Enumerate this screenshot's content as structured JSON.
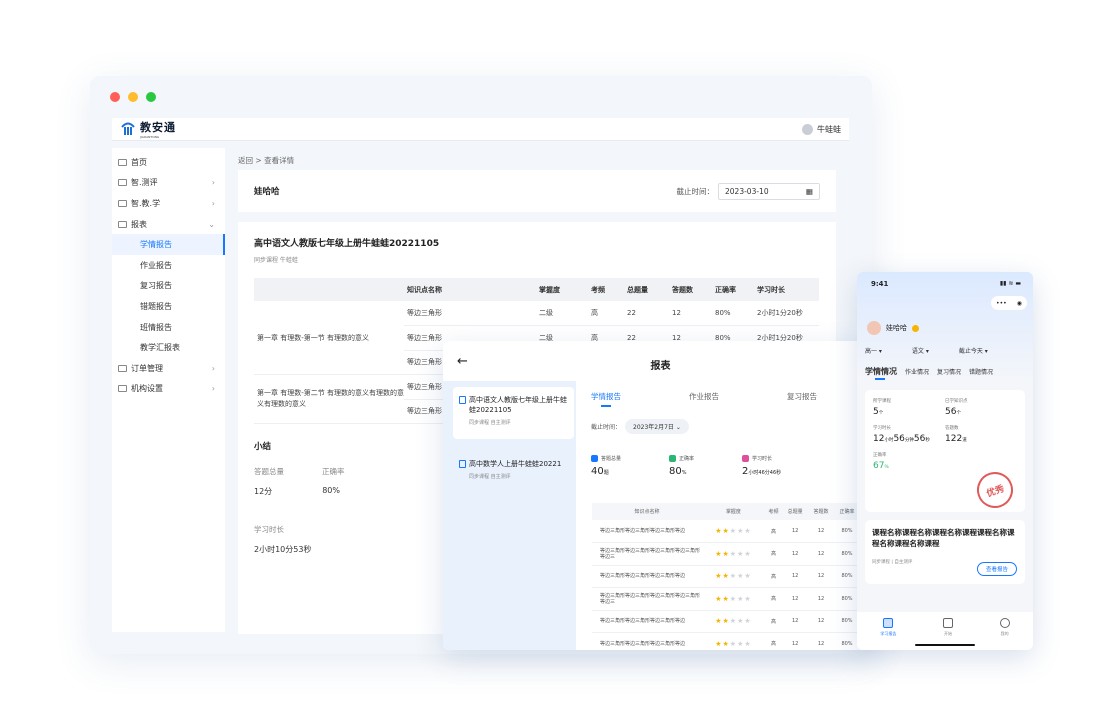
{
  "topbar": {
    "brand": "教安通",
    "brand_sub": "JIAOANTONG",
    "user": "牛蛙蛙"
  },
  "sidebar": {
    "items": [
      {
        "label": "首页",
        "chevron": ""
      },
      {
        "label": "智.测评",
        "chevron": "›"
      },
      {
        "label": "智.教.学",
        "chevron": "›"
      },
      {
        "label": "报表",
        "chevron": "⌄"
      }
    ],
    "report_sub": [
      "学情报告",
      "作业报告",
      "复习报告",
      "错题报告",
      "班情报告",
      "教学汇报表"
    ],
    "items_after": [
      {
        "label": "订单管理",
        "chevron": "›"
      },
      {
        "label": "机构设置",
        "chevron": "›"
      }
    ]
  },
  "breadcrumb": {
    "back": "返回",
    "sep": ">",
    "current": "查看详情"
  },
  "header": {
    "student": "娃哈哈",
    "date_label": "截止时间：",
    "date_value": "2023-03-10"
  },
  "report": {
    "title": "高中语文人教版七年级上册牛蛙蛙20221105",
    "tags": "同步课程    牛蛙蛙",
    "columns": [
      "知识点名称",
      "掌握度",
      "考频",
      "总题量",
      "答题数",
      "正确率",
      "学习时长"
    ],
    "chapter1": "第一章 有理数-第一节 有理数的意义",
    "chapter2": "第一章 有理数-第二节 有理数的意义有理数的意义有理数的意义",
    "rows": [
      {
        "name": "等边三角形",
        "level": "二级",
        "freq": "高",
        "total": "22",
        "answered": "12",
        "rate": "80%",
        "time": "2小时1分20秒"
      },
      {
        "name": "等边三角形",
        "level": "二级",
        "freq": "高",
        "total": "22",
        "answered": "12",
        "rate": "80%",
        "time": "2小时1分20秒"
      },
      {
        "name": "等边三角形",
        "level": "",
        "freq": "",
        "total": "",
        "answered": "",
        "rate": "",
        "time": ""
      },
      {
        "name": "等边三角形",
        "level": "",
        "freq": "",
        "total": "",
        "answered": "",
        "rate": "",
        "time": ""
      },
      {
        "name": "等边三角形",
        "level": "",
        "freq": "",
        "total": "",
        "answered": "",
        "rate": "",
        "time": ""
      }
    ],
    "summary": {
      "title": "小结",
      "labels": [
        "答题总量",
        "正确率"
      ],
      "values": [
        "12分",
        "80%"
      ],
      "time_label": "学习时长",
      "time_value": "2小时10分53秒"
    }
  },
  "tablet": {
    "title": "报表",
    "courses": [
      {
        "name": "高中语文人教版七年级上册牛蛙蛙20221105",
        "tags": "同步课程    自主测评"
      },
      {
        "name": "高中数学人上册牛蛙蛙20221",
        "tags": "同步课程    自主测评"
      }
    ],
    "tabs": [
      "学情报告",
      "作业报告",
      "复习报告"
    ],
    "date_label": "截止时间：",
    "date_value": "2023年2月7日",
    "stats": [
      {
        "label": "答题总量",
        "value": "40",
        "unit": "题",
        "color": "#1677ff"
      },
      {
        "label": "正确率",
        "value": "80",
        "unit": "%",
        "color": "#2bb673"
      },
      {
        "label": "学习时长",
        "value": "2",
        "unit": "小时46分46秒",
        "color": "#e0509a"
      }
    ],
    "columns": [
      "知识点名称",
      "掌握度",
      "考频",
      "总题量",
      "答题数",
      "正确率"
    ],
    "rows": [
      {
        "name": "等边三角形等边三角形等边三角形等边",
        "stars": 2,
        "freq": "高",
        "total": "12",
        "answered": "12",
        "rate": "80%"
      },
      {
        "name": "等边三角形等边三角形等边三角形等边三角形等边三",
        "stars": 2,
        "freq": "高",
        "total": "12",
        "answered": "12",
        "rate": "80%"
      },
      {
        "name": "等边三角形等边三角形等边三角形等边",
        "stars": 2,
        "freq": "高",
        "total": "12",
        "answered": "12",
        "rate": "80%"
      },
      {
        "name": "等边三角形等边三角形等边三角形等边三角形等边三",
        "stars": 2,
        "freq": "高",
        "total": "12",
        "answered": "12",
        "rate": "80%"
      },
      {
        "name": "等边三角形等边三角形等边三角形等边",
        "stars": 2,
        "freq": "高",
        "total": "12",
        "answered": "12",
        "rate": "80%"
      },
      {
        "name": "等边三角形等边三角形等边三角形等边",
        "stars": 2,
        "freq": "高",
        "total": "12",
        "answered": "12",
        "rate": "80%"
      }
    ]
  },
  "phone": {
    "time": "9:41",
    "status": "▮▮ ≋ ▬",
    "capsule": [
      "•••",
      "◉"
    ],
    "user": "娃哈哈",
    "filters": [
      "高一 ▾",
      "语文 ▾",
      "截止今天 ▾"
    ],
    "tabs": [
      "学情情况",
      "作业情况",
      "复习情况",
      "错题情况"
    ],
    "stats": [
      {
        "label": "所学课程",
        "value": "5",
        "unit": "个"
      },
      {
        "label": "已学知识点",
        "value": "56",
        "unit": "个"
      },
      {
        "label": "学习时长",
        "value": "12",
        "unit": "小时",
        "value2": "56",
        "unit2": "分钟",
        "value3": "56",
        "unit3": "秒"
      },
      {
        "label": "答题数",
        "value": "122",
        "unit": "道"
      },
      {
        "label": "正确率",
        "value": "67",
        "unit": "%"
      }
    ],
    "stamp": "优秀",
    "course_title": "课程名称课程名称课程名称课程课程名称课程名称课程名称课程",
    "course_tags": "同步课程  |  自主测评",
    "view_btn": "查看报告",
    "nav": [
      "学习报告",
      "开始",
      "我的"
    ]
  }
}
